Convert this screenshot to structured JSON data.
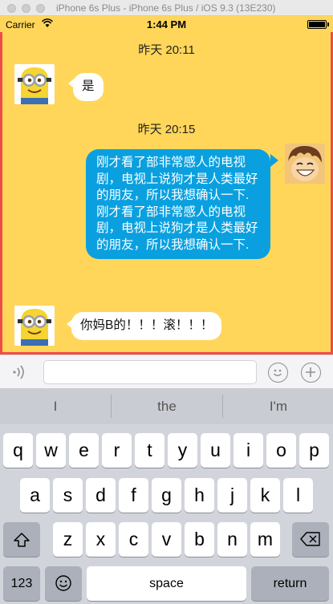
{
  "window": {
    "title": "iPhone 6s Plus - iPhone 6s Plus / iOS 9.3 (13E230)"
  },
  "status_bar": {
    "carrier": "Carrier",
    "time": "1:44 PM"
  },
  "chat": {
    "messages": [
      {
        "timestamp": "昨天 20:11",
        "sender": "other",
        "text": "是"
      },
      {
        "timestamp": "昨天 20:15",
        "sender": "self",
        "text": "刚才看了部非常感人的电视剧，电视上说狗才是人类最好的朋友，所以我想确认一下.刚才看了部非常感人的电视剧，电视上说狗才是人类最好的朋友，所以我想确认一下."
      },
      {
        "sender": "other",
        "text": "你妈B的！！！滚！！！"
      }
    ]
  },
  "input": {
    "value": "",
    "placeholder": ""
  },
  "keyboard": {
    "suggestions": [
      "I",
      "the",
      "I'm"
    ],
    "row1": [
      "q",
      "w",
      "e",
      "r",
      "t",
      "y",
      "u",
      "i",
      "o",
      "p"
    ],
    "row2": [
      "a",
      "s",
      "d",
      "f",
      "g",
      "h",
      "j",
      "k",
      "l"
    ],
    "row3": [
      "z",
      "x",
      "c",
      "v",
      "b",
      "n",
      "m"
    ],
    "numbers_label": "123",
    "space_label": "space",
    "return_label": "return"
  },
  "icons": {
    "voice": "voice-wave-icon",
    "emoji": "emoji-icon",
    "add": "add-icon",
    "shift": "shift-icon",
    "delete": "delete-icon",
    "globe_emoji": "emoji-key-icon"
  },
  "colors": {
    "chat_background": "#ffd65a",
    "outgoing_bubble": "#0aa0e0",
    "incoming_bubble": "#ffffff",
    "highlight_border": "#f04b4b",
    "keyboard_background": "#d1d4da"
  }
}
